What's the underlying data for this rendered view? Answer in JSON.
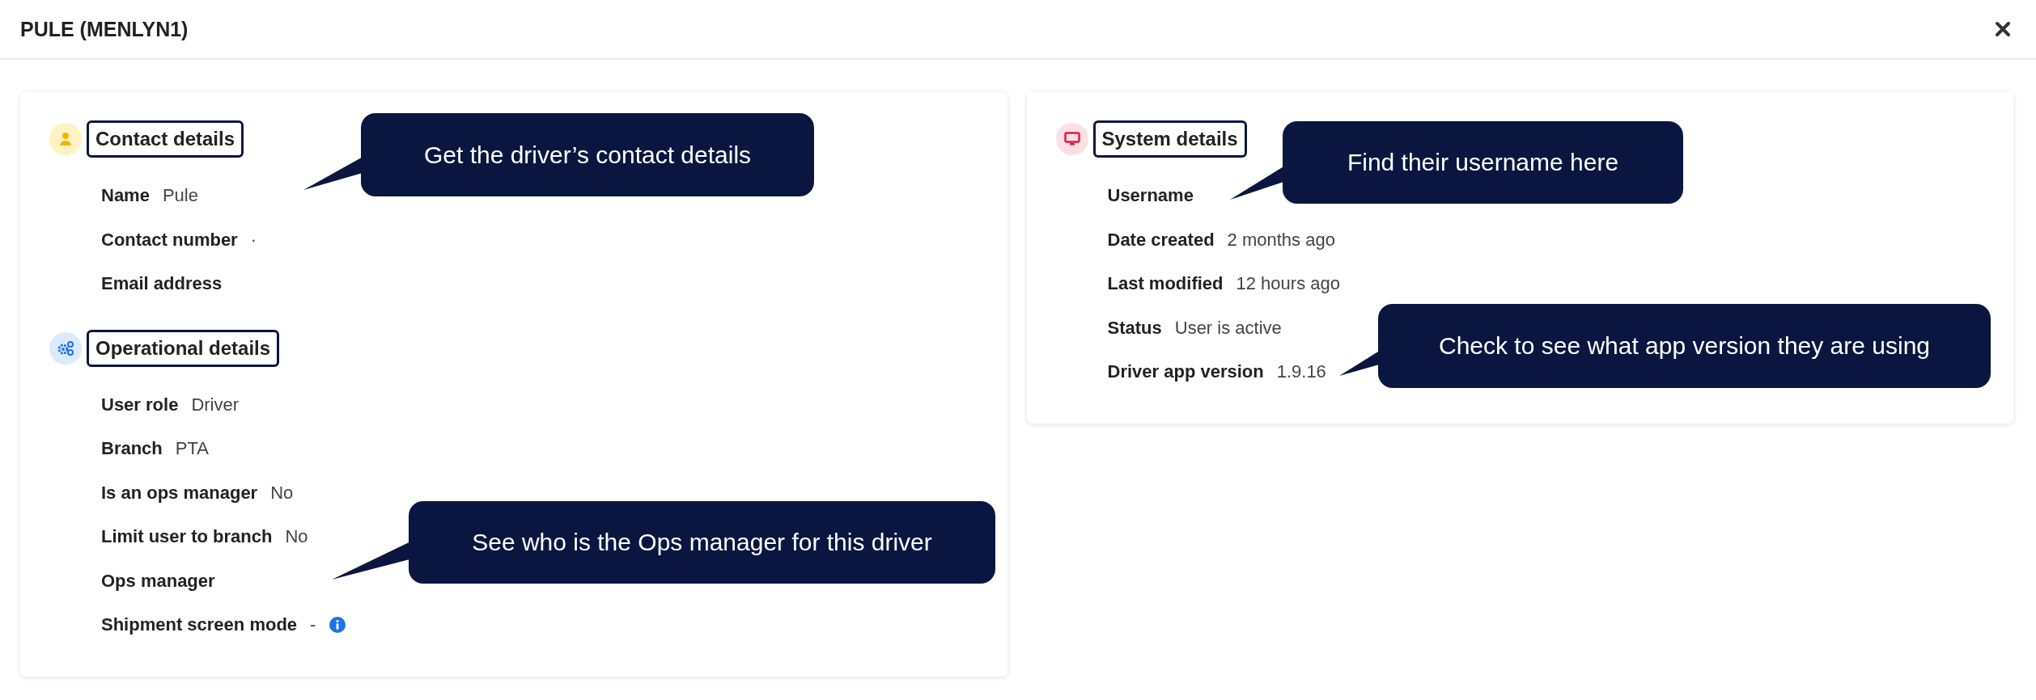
{
  "window": {
    "title": "PULE (MENLYN1)"
  },
  "columns": [
    {
      "sections": [
        {
          "kind": "contact",
          "title": "Contact details",
          "outlined": true,
          "fields": [
            {
              "label": "Name",
              "value": "Pule"
            },
            {
              "label": "Contact number",
              "value": "·"
            },
            {
              "label": "Email address"
            }
          ]
        },
        {
          "kind": "operational",
          "title": "Operational details",
          "outlined": true,
          "fields": [
            {
              "label": "User role",
              "value": "Driver"
            },
            {
              "label": "Branch",
              "value": "PTA"
            },
            {
              "label": "Is an ops manager",
              "value": "No"
            },
            {
              "label": "Limit user to branch",
              "value": "No"
            },
            {
              "label": "Ops manager"
            },
            {
              "label": "Shipment screen mode",
              "value": "-",
              "info": true
            }
          ]
        }
      ]
    },
    {
      "sections": [
        {
          "kind": "system",
          "title": "System details",
          "outlined": true,
          "fields": [
            {
              "label": "Username"
            },
            {
              "label": "Date created",
              "value": "2 months ago"
            },
            {
              "label": "Last modified",
              "value": "12 hours ago"
            },
            {
              "label": "Status",
              "value": "User is active"
            },
            {
              "label": "Driver app version",
              "value": "1.9.16"
            }
          ]
        }
      ]
    }
  ],
  "callouts": [
    {
      "text": "Get the driver’s contact details"
    },
    {
      "text": "Find their username here"
    },
    {
      "text": "Check to see what app version they are using"
    },
    {
      "text": "See who is the Ops manager for this driver"
    }
  ]
}
